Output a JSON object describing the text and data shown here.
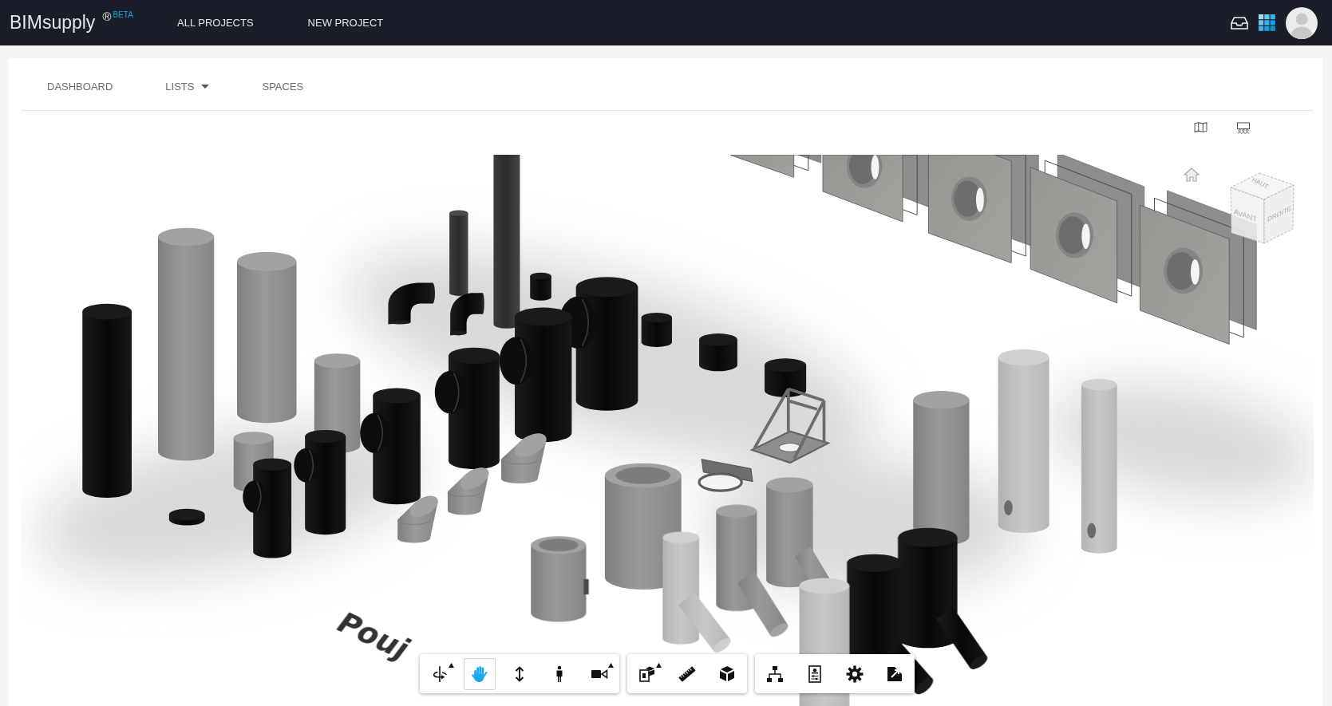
{
  "top_bar": {
    "brand": "BIMsupply",
    "brand_mark": "®",
    "badge": "BETA",
    "nav": [
      "ALL PROJECTS",
      "NEW PROJECT"
    ]
  },
  "tabs": [
    {
      "label": "DASHBOARD",
      "dropdown": false
    },
    {
      "label": "LISTS",
      "dropdown": true
    },
    {
      "label": "SPACES",
      "dropdown": false
    }
  ],
  "viewer": {
    "model_text": "Pouj",
    "view_cube": {
      "top": "HAUT",
      "front": "AVANT",
      "right": "DROITE"
    },
    "toolbar": [
      {
        "buttons": [
          {
            "selected": false,
            "flyout": true
          },
          {
            "selected": true,
            "flyout": false
          },
          {
            "selected": false,
            "flyout": false
          },
          {
            "selected": false,
            "flyout": false
          },
          {
            "selected": false,
            "flyout": true
          }
        ]
      },
      {
        "buttons": [
          {
            "selected": false,
            "flyout": true
          },
          {
            "selected": false,
            "flyout": false
          },
          {
            "selected": false,
            "flyout": false
          }
        ]
      },
      {
        "buttons": [
          {
            "selected": false,
            "flyout": false
          },
          {
            "selected": false,
            "flyout": false
          },
          {
            "selected": false,
            "flyout": false
          },
          {
            "selected": false,
            "flyout": false
          }
        ]
      }
    ]
  }
}
